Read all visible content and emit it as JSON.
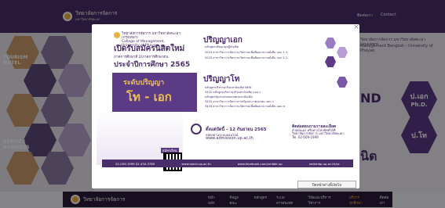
{
  "site": {
    "brand_name": "วิทยาลัยการจัดการ",
    "brand_sub": "มหาวิทยาลัยพะเยา",
    "topnav": [
      "ติดต่อเรา",
      "Contact"
    ],
    "bottomnav": [
      "หน้าหลัก",
      "ข้อมูลคณะ",
      "หลักสูตร",
      "ระบบสารสนเทศ",
      "วิจัยและบริการวิชาการ",
      "บริการนักศึกษา",
      "ติดต่อเรา"
    ],
    "left_tags": [
      "TOURISM HOTEL",
      "SERVICE BUSINESS"
    ],
    "right_text_line1": "วิทยาลัยการจัดการ มหาวิทยาลัยพะเยา (กรุงเทพฯ)",
    "right_text_line2": "Management Bangkok - University of Phayao",
    "right_big": "ND",
    "right_big2": "นิต",
    "phd_label_th": "ป.เอก",
    "phd_label_en": "Ph.D.",
    "master_label": "ป.โท"
  },
  "modal": {
    "uni_name": "วิทยาลัยการจัดการ มหาวิทยาลัยพะเยา (กรุงเทพฯ)",
    "uni_name_en": "College of Management, University of Phayao",
    "headline1": "เปิดรับสมัครนิสิตใหม่",
    "headline2": "ภาคการศึกษาที่ 2/ภาคการศึกษาต้น",
    "headline3": "ประจำปีการศึกษา 2565",
    "level_label": "ระดับปริญญา",
    "level_value": "โท - เอก",
    "qr_label": "สมัครเรียน",
    "doctoral_title": "ปริญญาเอก",
    "doctoral_lines": [
      "หลักสูตรปรัชญาดุษฎีบัณฑิต",
      "2019 สาขาวิชาการจัดการนวัตกรรมเพื่อพัฒนาความยั่งยืน แบบ 1.1",
      "2020 สาขาวิชาการจัดการนวัตกรรมเพื่อพัฒนาความยั่งยืน แบบ 2.1"
    ],
    "master_title": "ปริญญาโท",
    "master_lines": [
      "หลักสูตรบริหารธุรกิจมหาบัณฑิต NEW",
      "3432 หลักสูตรบริหารธุรกิจมหาบัณฑิต แผน ก",
      "หลักสูตรรัฐประศาสนศาสตรมหาบัณฑิต",
      "3433 สาขาวิชาการจัดการภาครัฐและภาคเอกชน แผน ก",
      "3434 สาขาวิชาการจัดการนวัตกรรมเพื่อพัฒนาความยั่งยืน แผน ข"
    ],
    "apply_date": "ตั้งแต่บัดนี้ - 12 กันยายน 2565",
    "apply_via": "สมัครผ่านระบบออนไลน์",
    "apply_url": "www.admission.up.ac.th",
    "contact_title": "ติดต่อสอบถามรายละเอียด",
    "contact_sub": "ด้วยตนเอง หรือทางโทรศัพท์ได้ที่",
    "contact_lines": [
      "วิทยาลัยการจัดการ มหาวิทยาลัยพะเยา",
      "Tel. 02-009-1999"
    ],
    "info_bar": [
      "02-009-1999 02-434-3785",
      "www.sarch.up.ac.th",
      "www.facebook.com/smbbk.up",
      "smbmbp.up.ac.th/ac"
    ],
    "footer_button": "ปิดหน้าต่างนี้/ถัดไป"
  }
}
